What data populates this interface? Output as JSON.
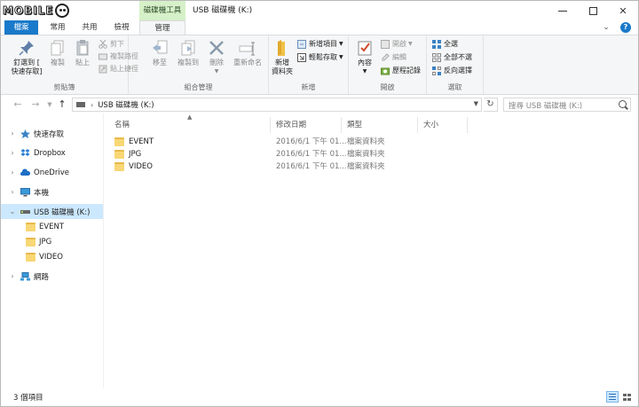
{
  "titlebar": {
    "logo_text": "MOBILE",
    "context_tab": "磁碟機工具",
    "title": "USB 磁碟機 (K:)",
    "minimize_symbol": "—",
    "close_symbol": "✕"
  },
  "tabs": {
    "file": "檔案",
    "home": "常用",
    "share": "共用",
    "view": "檢視",
    "manage": "管理",
    "expand_symbol": "⌄",
    "help_symbol": "?"
  },
  "ribbon": {
    "clipboard": {
      "label": "剪貼簿",
      "pin_line1": "釘選到 [",
      "pin_line2": "快速存取]",
      "copy": "複製",
      "paste": "貼上",
      "cut": "剪下",
      "copy_path": "複製路徑",
      "paste_shortcut": "貼上捷徑"
    },
    "organize": {
      "label": "組合管理",
      "move_to": "移至",
      "copy_to": "複製到",
      "delete": "刪除",
      "rename": "重新命名"
    },
    "new": {
      "label": "新增",
      "new_folder_line1": "新增",
      "new_folder_line2": "資料夾",
      "new_item": "新增項目",
      "easy_access": "輕鬆存取"
    },
    "open": {
      "label": "開啟",
      "properties": "內容",
      "open": "開啟",
      "edit": "編輯",
      "history": "歷程記錄"
    },
    "select": {
      "label": "選取",
      "select_all": "全選",
      "select_none": "全部不選",
      "invert": "反向選擇"
    }
  },
  "address": {
    "path": "USB 磁碟機 (K:)",
    "separator": "›",
    "search_placeholder": "搜尋 USB 磁碟機 (K:)",
    "refresh_symbol": "↻",
    "back_symbol": "←",
    "forward_symbol": "→",
    "up_symbol": "↑"
  },
  "nav": {
    "items": [
      {
        "label": "快速存取"
      },
      {
        "label": "Dropbox"
      },
      {
        "label": "OneDrive"
      },
      {
        "label": "本機"
      },
      {
        "label": "USB 磁碟機 (K:)"
      },
      {
        "label": "EVENT"
      },
      {
        "label": "JPG"
      },
      {
        "label": "VIDEO"
      },
      {
        "label": "網路"
      }
    ]
  },
  "columns": {
    "name": "名稱",
    "date": "修改日期",
    "type": "類型",
    "size": "大小"
  },
  "files": [
    {
      "name": "EVENT",
      "date": "2016/6/1 下午 01...",
      "type": "檔案資料夾"
    },
    {
      "name": "JPG",
      "date": "2016/6/1 下午 01...",
      "type": "檔案資料夾"
    },
    {
      "name": "VIDEO",
      "date": "2016/6/1 下午 01...",
      "type": "檔案資料夾"
    }
  ],
  "status": {
    "count": "3 個項目"
  },
  "colors": {
    "accent": "#1979ca",
    "context_tab": "#d6f0c8",
    "selection": "#cce8ff",
    "folder": "#f8d775"
  }
}
